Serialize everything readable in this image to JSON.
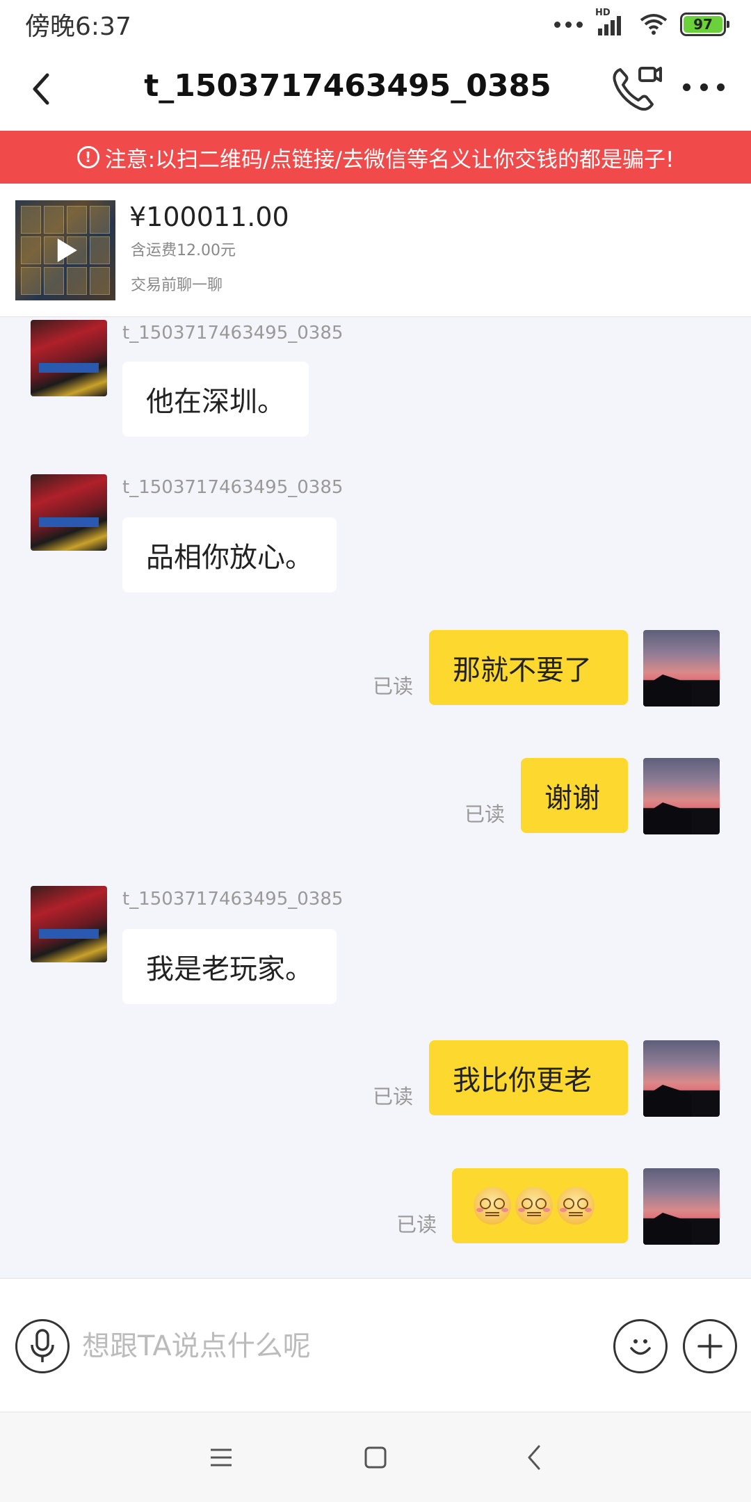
{
  "status_bar": {
    "time": "傍晚6:37",
    "network": "HD",
    "battery": "97"
  },
  "header": {
    "title": "t_1503717463495_0385"
  },
  "warning": {
    "text": "注意:以扫二维码/点链接/去微信等名义让你交钱的都是骗子!"
  },
  "product": {
    "price": "¥100011.00",
    "shipping": "含运费12.00元",
    "hint": "交易前聊一聊"
  },
  "messages": [
    {
      "from": "them",
      "sender": "t_1503717463495_0385",
      "text": "他在深圳。"
    },
    {
      "from": "them",
      "sender": "t_1503717463495_0385",
      "text": "品相你放心。"
    },
    {
      "from": "me",
      "read": "已读",
      "text": "那就不要了"
    },
    {
      "from": "me",
      "read": "已读",
      "text": "谢谢"
    },
    {
      "from": "them",
      "sender": "t_1503717463495_0385",
      "text": "我是老玩家。"
    },
    {
      "from": "me",
      "read": "已读",
      "text": "我比你更老"
    },
    {
      "from": "me",
      "read": "已读",
      "emoji_count": 3
    }
  ],
  "input": {
    "placeholder": "想跟TA说点什么呢"
  },
  "colors": {
    "warning": "#f14a4a",
    "my_bubble": "#fdd92f",
    "their_bubble": "#ffffff",
    "chat_bg": "#f4f5fa",
    "battery": "#6bd13a"
  }
}
